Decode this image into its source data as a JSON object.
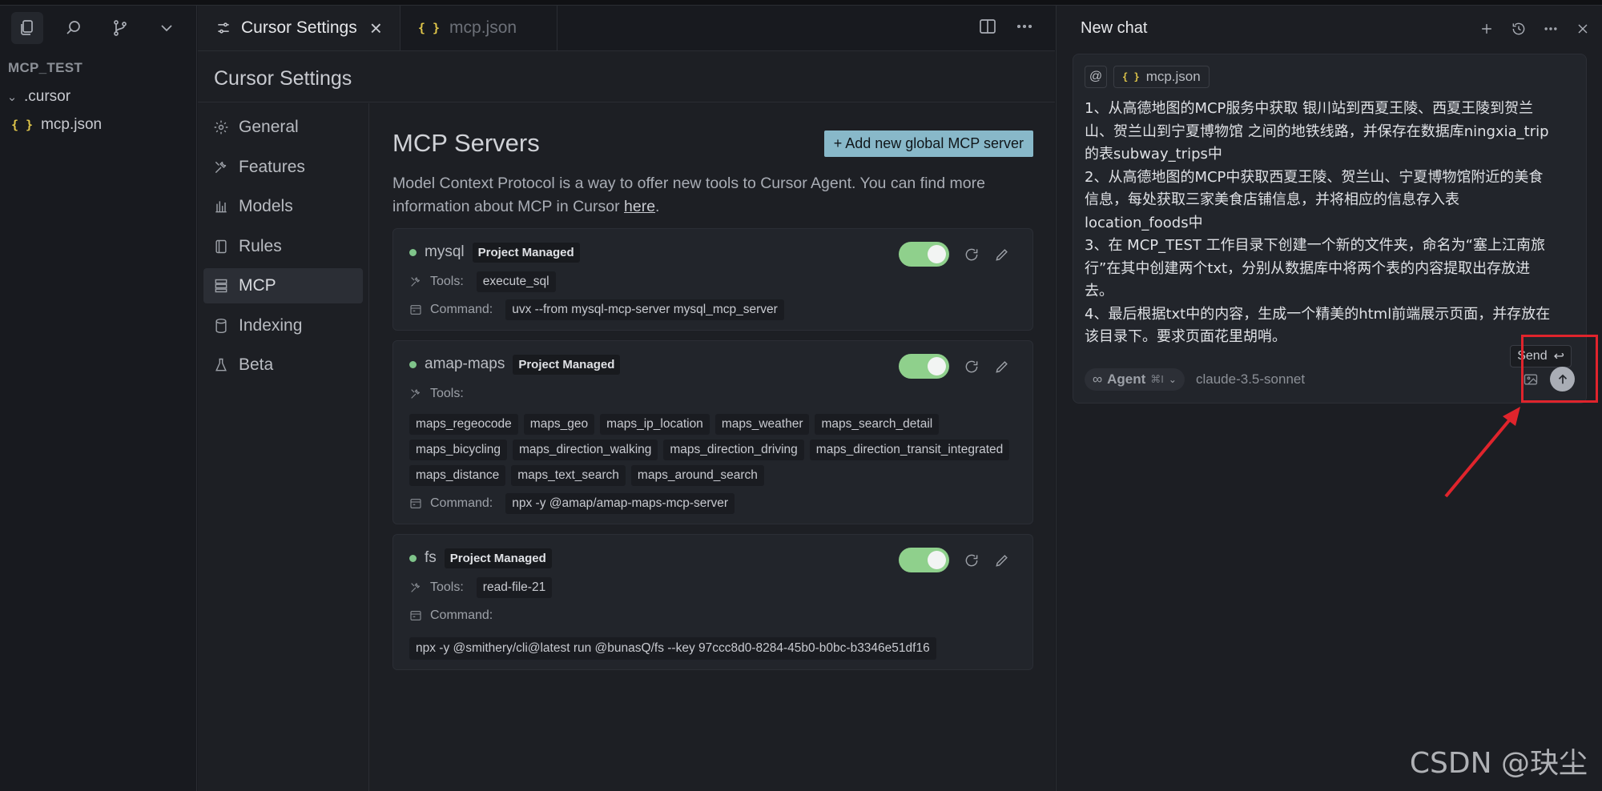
{
  "explorer": {
    "project": "MCP_TEST",
    "folder": ".cursor",
    "file": "mcp.json",
    "json_glyph": "{ }"
  },
  "tabs": [
    {
      "label": "Cursor Settings",
      "close": "×"
    },
    {
      "label": "mcp.json",
      "glyph": "{ }"
    }
  ],
  "settings": {
    "title": "Cursor Settings",
    "nav": [
      "General",
      "Features",
      "Models",
      "Rules",
      "MCP",
      "Indexing",
      "Beta"
    ],
    "active_nav": "MCP",
    "mcp": {
      "title": "MCP Servers",
      "add_button": "+ Add new global MCP server",
      "desc_before": "Model Context Protocol is a way to offer new tools to Cursor Agent. You can find more information about MCP in Cursor ",
      "desc_link": "here",
      "desc_after": ".",
      "tools_label": "Tools:",
      "command_label": "Command:",
      "servers": [
        {
          "name": "mysql",
          "badge": "Project Managed",
          "enabled": true,
          "tools": [
            "execute_sql"
          ],
          "command": "uvx --from mysql-mcp-server mysql_mcp_server"
        },
        {
          "name": "amap-maps",
          "badge": "Project Managed",
          "enabled": true,
          "tools": [
            "maps_regeocode",
            "maps_geo",
            "maps_ip_location",
            "maps_weather",
            "maps_search_detail",
            "maps_bicycling",
            "maps_direction_walking",
            "maps_direction_driving",
            "maps_direction_transit_integrated",
            "maps_distance",
            "maps_text_search",
            "maps_around_search"
          ],
          "command": "npx -y @amap/amap-maps-mcp-server"
        },
        {
          "name": "fs",
          "badge": "Project Managed",
          "enabled": true,
          "tools": [
            "read-file-21"
          ],
          "command": "npx -y @smithery/cli@latest run @bunasQ/fs --key 97ccc8d0-8284-45b0-b0bc-b3346e51df16"
        }
      ]
    }
  },
  "chat": {
    "title": "New chat",
    "context_at": "@",
    "context_file": "mcp.json",
    "message": "1、从高德地图的MCP服务中获取 银川站到西夏王陵、西夏王陵到贺兰\n山、贺兰山到宁夏博物馆 之间的地铁线路，并保存在数据库ningxia_trip\n的表subway_trips中\n2、从高德地图的MCP中获取西夏王陵、贺兰山、宁夏博物馆附近的美食\n信息，每处获取三家美食店铺信息，并将相应的信息存入表\nlocation_foods中\n3、在 MCP_TEST 工作目录下创建一个新的文件夹，命名为“塞上江南旅\n行”在其中创建两个txt，分别从数据库中将两个表的内容提取出存放进\n去。\n4、最后根据txt中的内容，生成一个精美的html前端展示页面，并存放在\n该目录下。要求页面花里胡哨。",
    "agent_symbol": "∞",
    "agent_label": "Agent",
    "agent_shortcut": "⌘I",
    "model": "claude-3.5-sonnet",
    "send_tip": "Send",
    "send_key": "↩"
  },
  "watermark": "CSDN @玦尘",
  "colors": {
    "accent": "#88b8c9",
    "toggle_on": "#8fd08c",
    "status_dot": "#7fc48a",
    "annotation": "#e0242c"
  }
}
